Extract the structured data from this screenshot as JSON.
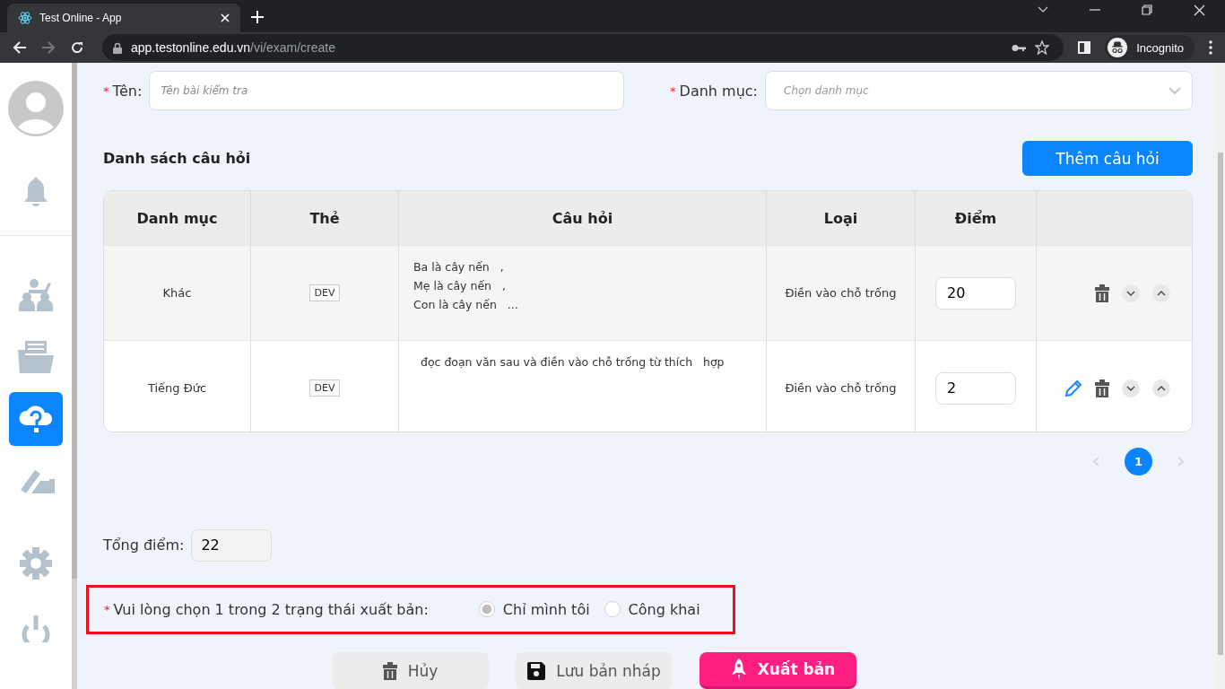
{
  "browser": {
    "tab_title": "Test Online - App",
    "url_host": "app.testonline.edu.vn",
    "url_path": "/vi/exam/create",
    "profile_label": "Incognito"
  },
  "sidebar": {
    "items": [
      {
        "kind": "avatar",
        "selected": false
      },
      {
        "kind": "bell",
        "selected": false
      },
      {
        "kind": "group",
        "selected": false
      },
      {
        "kind": "folder",
        "selected": false
      },
      {
        "kind": "cloud-question",
        "selected": true
      },
      {
        "kind": "writing",
        "selected": false
      },
      {
        "kind": "gear",
        "selected": false
      },
      {
        "kind": "power",
        "selected": false
      }
    ]
  },
  "form": {
    "name_required_mark": "*",
    "name_label": "Tên:",
    "category_required_mark": "*",
    "name_placeholder": "Tên bài kiểm tra",
    "category_label": "Danh mục:",
    "category_placeholder": "Chọn danh mục"
  },
  "questions": {
    "title": "Danh sách câu hỏi",
    "add_button": "Thêm câu hỏi",
    "columns": [
      "Danh mục",
      "Thẻ",
      "Câu hỏi",
      "Loại",
      "Điểm"
    ],
    "rows": [
      {
        "category": "Khác",
        "tag": "DEV",
        "question_lines": [
          "Ba là cây nến   ,",
          "Mẹ là cây nến   ,",
          "Con là cây nến   ..."
        ],
        "type": "Điền vào chỗ trống",
        "score": "20",
        "editable": false
      },
      {
        "category": "Tiếng Đức",
        "tag": "DEV",
        "question_lines": [
          "  đọc đoạn văn sau và điền vào chỗ trống từ thích   hợp"
        ],
        "type": "Điền vào chỗ trống",
        "score": "2",
        "editable": true
      }
    ]
  },
  "pagination": {
    "pages": [
      {
        "label": "1",
        "selected": true
      }
    ]
  },
  "total": {
    "label": "Tổng điểm:",
    "value": "22"
  },
  "publish": {
    "required_mark": "*",
    "label": "Vui lòng chọn 1 trong 2 trạng thái xuất bản:",
    "options": [
      {
        "label": "Chỉ mình tôi",
        "selected": true
      },
      {
        "label": "Công khai",
        "selected": false
      }
    ]
  },
  "actions": [
    {
      "kind": "cancel",
      "label": "Hủy"
    },
    {
      "kind": "draft",
      "label": "Lưu bản nháp"
    },
    {
      "kind": "publish",
      "label": "Xuất bản"
    }
  ]
}
